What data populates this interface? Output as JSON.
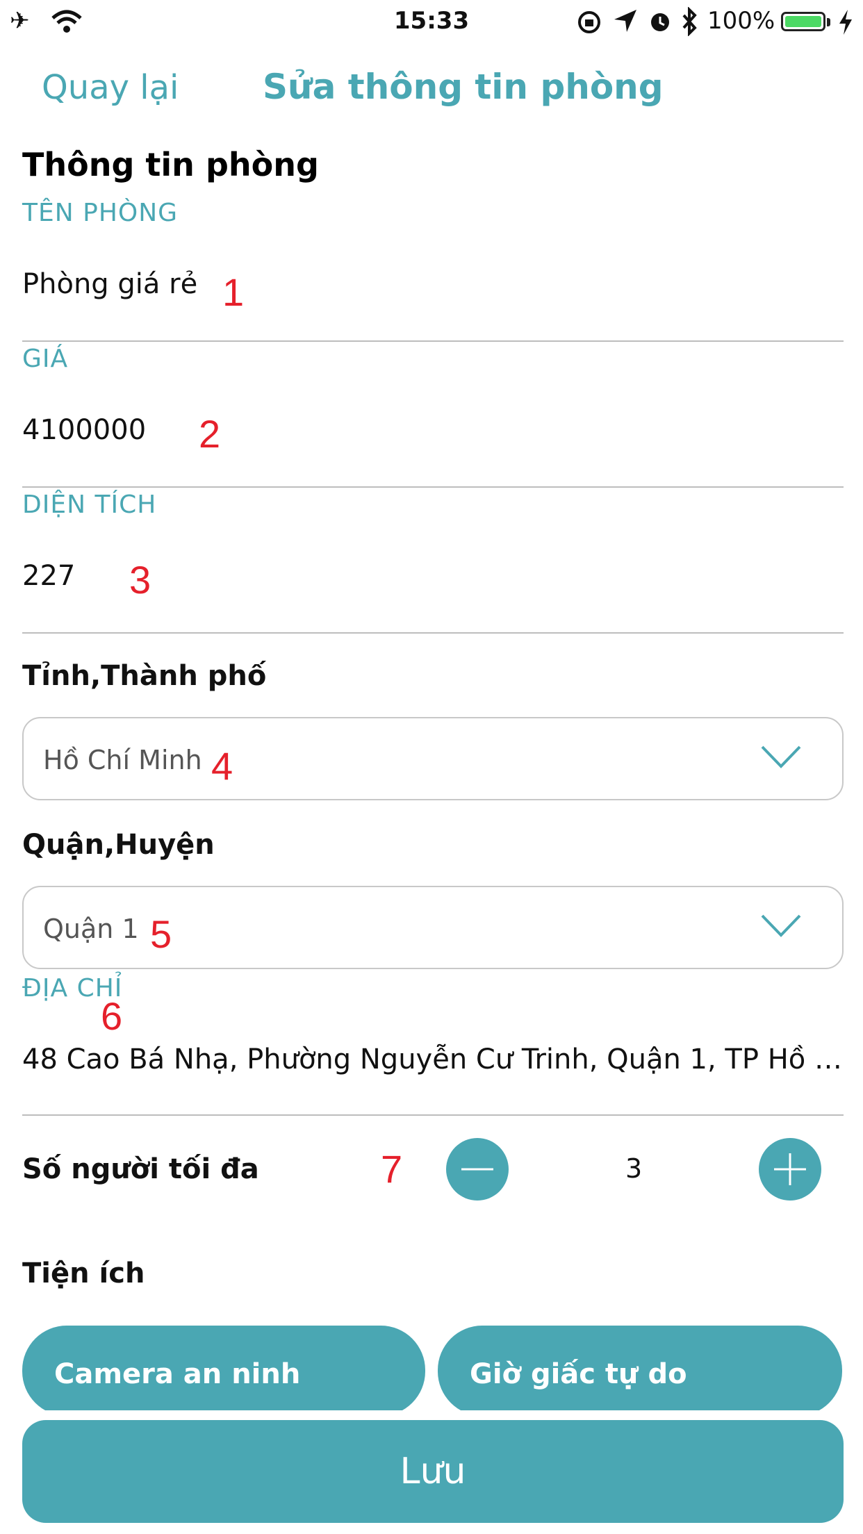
{
  "status_bar": {
    "time": "15:33",
    "battery_percent": "100%",
    "icons": [
      "airplane-icon",
      "wifi-icon",
      "orientation-lock-icon",
      "location-icon",
      "alarm-icon",
      "bluetooth-icon",
      "battery-icon",
      "charging-icon"
    ]
  },
  "nav": {
    "back_label": "Quay lại",
    "title": "Sửa thông tin phòng"
  },
  "section_title": "Thông tin phòng",
  "fields": {
    "room_name": {
      "label": "TÊN PHÒNG",
      "value": "Phòng giá rẻ",
      "annotation": "1"
    },
    "price": {
      "label": "GIÁ",
      "value": "4100000",
      "annotation": "2"
    },
    "area": {
      "label": "DIỆN TÍCH",
      "value": "227",
      "annotation": "3"
    },
    "address": {
      "label": "ĐỊA CHỈ",
      "value": "48 Cao Bá Nhạ, Phường Nguyễn Cư Trinh, Quận 1, TP Hồ C...",
      "annotation": "6"
    }
  },
  "city": {
    "label": "Tỉnh,Thành phố",
    "selected": "Hồ Chí Minh",
    "annotation": "4"
  },
  "district": {
    "label": "Quận,Huyện",
    "selected": "Quận 1",
    "annotation": "5"
  },
  "max_people": {
    "label": "Số người tối đa",
    "value": "3",
    "annotation": "7"
  },
  "amenities": {
    "label": "Tiện ích",
    "items": [
      "Camera an ninh",
      "Giờ giấc tự do"
    ]
  },
  "save_label": "Lưu",
  "colors": {
    "accent": "#4aa7b3",
    "annotation_red": "#e5202b",
    "battery_green": "#4cd964"
  }
}
